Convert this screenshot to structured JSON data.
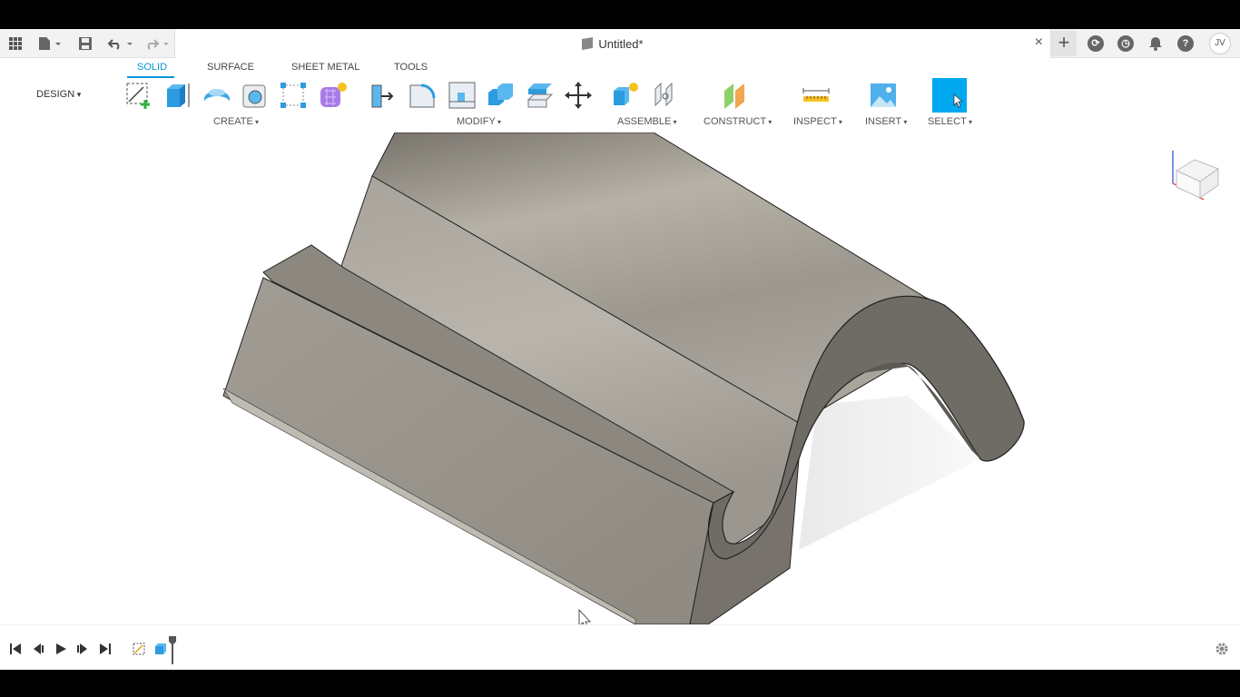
{
  "document": {
    "title": "Untitled*"
  },
  "user": {
    "initials": "JV"
  },
  "workspace": {
    "label": "DESIGN"
  },
  "tabs": [
    {
      "label": "SOLID",
      "active": true
    },
    {
      "label": "SURFACE",
      "active": false
    },
    {
      "label": "SHEET METAL",
      "active": false
    },
    {
      "label": "TOOLS",
      "active": false
    }
  ],
  "groups": {
    "create": "CREATE",
    "modify": "MODIFY",
    "assemble": "ASSEMBLE",
    "construct": "CONSTRUCT",
    "inspect": "INSPECT",
    "insert": "INSERT",
    "select": "SELECT"
  },
  "colors": {
    "accent": "#0696d7",
    "select": "#00a8f0",
    "body": "#8f8c85"
  },
  "icons": [
    "grid-icon",
    "file-icon",
    "save-icon",
    "undo-icon",
    "redo-icon",
    "close-icon",
    "plus-icon",
    "extensions-icon",
    "job-status-icon",
    "notifications-icon",
    "help-icon",
    "settings-gear-icon"
  ]
}
